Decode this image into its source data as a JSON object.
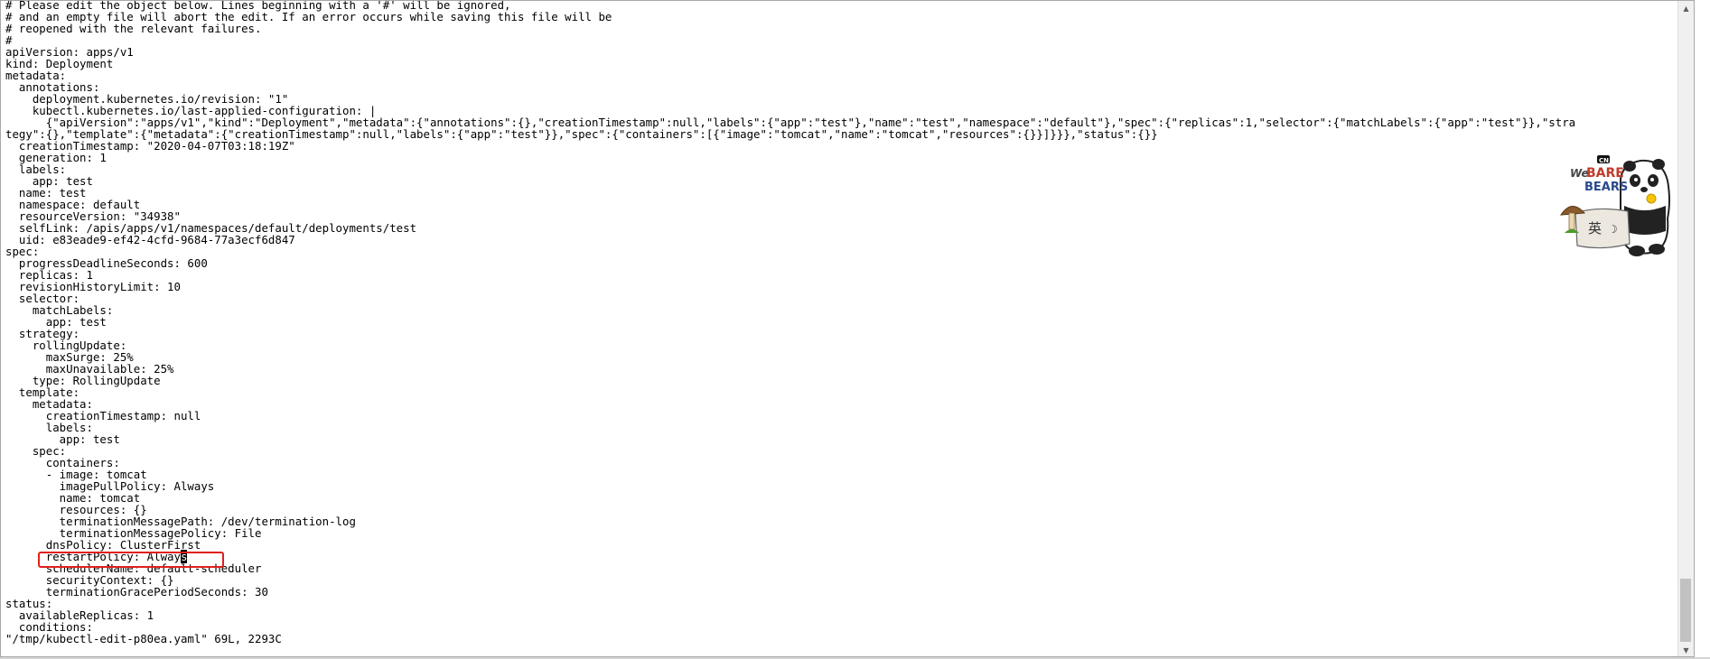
{
  "editor": {
    "lines": [
      "# Please edit the object below. Lines beginning with a '#' will be ignored,",
      "# and an empty file will abort the edit. If an error occurs while saving this file will be",
      "# reopened with the relevant failures.",
      "#",
      "apiVersion: apps/v1",
      "kind: Deployment",
      "metadata:",
      "  annotations:",
      "    deployment.kubernetes.io/revision: \"1\"",
      "    kubectl.kubernetes.io/last-applied-configuration: |",
      "      {\"apiVersion\":\"apps/v1\",\"kind\":\"Deployment\",\"metadata\":{\"annotations\":{},\"creationTimestamp\":null,\"labels\":{\"app\":\"test\"},\"name\":\"test\",\"namespace\":\"default\"},\"spec\":{\"replicas\":1,\"selector\":{\"matchLabels\":{\"app\":\"test\"}},\"stra",
      "tegy\":{},\"template\":{\"metadata\":{\"creationTimestamp\":null,\"labels\":{\"app\":\"test\"}},\"spec\":{\"containers\":[{\"image\":\"tomcat\",\"name\":\"tomcat\",\"resources\":{}}]}}},\"status\":{}}",
      "  creationTimestamp: \"2020-04-07T03:18:19Z\"",
      "  generation: 1",
      "  labels:",
      "    app: test",
      "  name: test",
      "  namespace: default",
      "  resourceVersion: \"34938\"",
      "  selfLink: /apis/apps/v1/namespaces/default/deployments/test",
      "  uid: e83eade9-ef42-4cfd-9684-77a3ecf6d847",
      "spec:",
      "  progressDeadlineSeconds: 600",
      "  replicas: 1",
      "  revisionHistoryLimit: 10",
      "  selector:",
      "    matchLabels:",
      "      app: test",
      "  strategy:",
      "    rollingUpdate:",
      "      maxSurge: 25%",
      "      maxUnavailable: 25%",
      "    type: RollingUpdate",
      "  template:",
      "    metadata:",
      "      creationTimestamp: null",
      "      labels:",
      "        app: test",
      "    spec:",
      "      containers:",
      "      - image: tomcat",
      "        imagePullPolicy: Always",
      "        name: tomcat",
      "        resources: {}",
      "        terminationMessagePath: /dev/termination-log",
      "        terminationMessagePolicy: File",
      "      dnsPolicy: ClusterFirst"
    ],
    "cursor_line": {
      "before": "      restartPolicy: Alway",
      "cursor_char": "s"
    },
    "lines_after": [
      "      schedulerName: default-scheduler",
      "      securityContext: {}",
      "      terminationGracePeriodSeconds: 30",
      "status:",
      "  availableReplicas: 1",
      "  conditions:"
    ],
    "status_line": "\"/tmp/kubectl-edit-p80ea.yaml\" 69L, 2293C"
  },
  "highlight": {
    "color": "#e0201c"
  },
  "mascot": {
    "icon": "panda-bear-icon",
    "cn_badge": "CN",
    "brand_we": "We",
    "brand_bare": "BARE",
    "brand_bears": "BEARS",
    "ime_char": "英",
    "moon_char": "☽"
  },
  "scrollbar": {
    "up_icon": "scroll-up-arrow-icon",
    "down_icon": "scroll-down-arrow-icon"
  }
}
